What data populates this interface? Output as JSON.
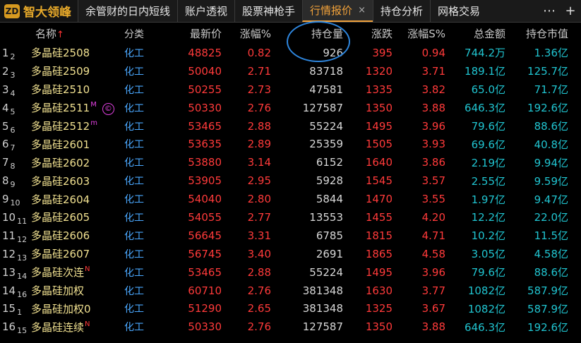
{
  "app": {
    "logo_mark": "ZD",
    "logo_text": "智大领峰"
  },
  "tabs": [
    {
      "label": "余管财的日内短线",
      "active": false
    },
    {
      "label": "账户透视",
      "active": false
    },
    {
      "label": "股票神枪手",
      "active": false
    },
    {
      "label": "行情报价",
      "active": true,
      "close": "×"
    },
    {
      "label": "持仓分析",
      "active": false
    },
    {
      "label": "网格交易",
      "active": false
    }
  ],
  "toolbar": {
    "more": "⋯",
    "add": "+"
  },
  "columns": {
    "name": "名称",
    "name_sort": "↑",
    "category": "分类",
    "price": "最新价",
    "pct": "涨幅%",
    "open_interest": "持仓量",
    "change": "涨跌",
    "pct_s": "涨幅S%",
    "amount": "总金额",
    "oi_value": "持仓市值"
  },
  "rows": [
    {
      "idx": "1",
      "sub": "2",
      "name": "多晶硅2508",
      "tag": "",
      "category": "化工",
      "price": "48825",
      "pct": "0.82",
      "oi": "926",
      "chg": "395",
      "pct_s": "0.94",
      "amt": "744.2万",
      "oi_value": "1.36亿"
    },
    {
      "idx": "2",
      "sub": "3",
      "name": "多晶硅2509",
      "tag": "",
      "category": "化工",
      "price": "50040",
      "pct": "2.71",
      "oi": "83718",
      "chg": "1320",
      "pct_s": "3.71",
      "amt": "189.1亿",
      "oi_value": "125.7亿"
    },
    {
      "idx": "3",
      "sub": "4",
      "name": "多晶硅2510",
      "tag": "",
      "category": "化工",
      "price": "50255",
      "pct": "2.73",
      "oi": "47581",
      "chg": "1335",
      "pct_s": "3.82",
      "amt": "65.0亿",
      "oi_value": "71.7亿"
    },
    {
      "idx": "4",
      "sub": "5",
      "name": "多晶硅2511",
      "tag": "M",
      "copy": "©",
      "category": "化工",
      "price": "50330",
      "pct": "2.76",
      "oi": "127587",
      "chg": "1350",
      "pct_s": "3.88",
      "amt": "646.3亿",
      "oi_value": "192.6亿"
    },
    {
      "idx": "5",
      "sub": "6",
      "name": "多晶硅2512",
      "tag": "m",
      "category": "化工",
      "price": "53465",
      "pct": "2.88",
      "oi": "55224",
      "chg": "1495",
      "pct_s": "3.96",
      "amt": "79.6亿",
      "oi_value": "88.6亿"
    },
    {
      "idx": "6",
      "sub": "7",
      "name": "多晶硅2601",
      "tag": "",
      "category": "化工",
      "price": "53635",
      "pct": "2.89",
      "oi": "25359",
      "chg": "1505",
      "pct_s": "3.93",
      "amt": "69.6亿",
      "oi_value": "40.8亿"
    },
    {
      "idx": "7",
      "sub": "8",
      "name": "多晶硅2602",
      "tag": "",
      "category": "化工",
      "price": "53880",
      "pct": "3.14",
      "oi": "6152",
      "chg": "1640",
      "pct_s": "3.86",
      "amt": "2.19亿",
      "oi_value": "9.94亿"
    },
    {
      "idx": "8",
      "sub": "9",
      "name": "多晶硅2603",
      "tag": "",
      "category": "化工",
      "price": "53905",
      "pct": "2.95",
      "oi": "5928",
      "chg": "1545",
      "pct_s": "3.57",
      "amt": "2.55亿",
      "oi_value": "9.59亿"
    },
    {
      "idx": "9",
      "sub": "10",
      "name": "多晶硅2604",
      "tag": "",
      "category": "化工",
      "price": "54040",
      "pct": "2.80",
      "oi": "5844",
      "chg": "1470",
      "pct_s": "3.55",
      "amt": "1.97亿",
      "oi_value": "9.47亿"
    },
    {
      "idx": "10",
      "sub": "11",
      "name": "多晶硅2605",
      "tag": "",
      "category": "化工",
      "price": "54055",
      "pct": "2.77",
      "oi": "13553",
      "chg": "1455",
      "pct_s": "4.20",
      "amt": "12.2亿",
      "oi_value": "22.0亿"
    },
    {
      "idx": "11",
      "sub": "12",
      "name": "多晶硅2606",
      "tag": "",
      "category": "化工",
      "price": "56645",
      "pct": "3.31",
      "oi": "6785",
      "chg": "1815",
      "pct_s": "4.71",
      "amt": "10.2亿",
      "oi_value": "11.5亿"
    },
    {
      "idx": "12",
      "sub": "13",
      "name": "多晶硅2607",
      "tag": "",
      "category": "化工",
      "price": "56745",
      "pct": "3.40",
      "oi": "2691",
      "chg": "1865",
      "pct_s": "4.58",
      "amt": "3.05亿",
      "oi_value": "4.58亿"
    },
    {
      "idx": "13",
      "sub": "14",
      "name": "多晶硅次连",
      "tag": "N",
      "category": "化工",
      "price": "53465",
      "pct": "2.88",
      "oi": "55224",
      "chg": "1495",
      "pct_s": "3.96",
      "amt": "79.6亿",
      "oi_value": "88.6亿"
    },
    {
      "idx": "14",
      "sub": "16",
      "name": "多晶硅加权",
      "tag": "",
      "category": "化工",
      "price": "60710",
      "pct": "2.76",
      "oi": "381348",
      "chg": "1630",
      "pct_s": "3.77",
      "amt": "1082亿",
      "oi_value": "587.9亿"
    },
    {
      "idx": "15",
      "sub": "1",
      "name": "多晶硅加权0",
      "tag": "",
      "category": "化工",
      "price": "51290",
      "pct": "2.65",
      "oi": "381348",
      "chg": "1325",
      "pct_s": "3.67",
      "amt": "1082亿",
      "oi_value": "587.9亿"
    },
    {
      "idx": "16",
      "sub": "15",
      "name": "多晶硅连续",
      "tag": "N",
      "category": "化工",
      "price": "50330",
      "pct": "2.76",
      "oi": "127587",
      "chg": "1350",
      "pct_s": "3.88",
      "amt": "646.3亿",
      "oi_value": "192.6亿"
    }
  ],
  "colors": {
    "up": "#ff3a3a",
    "name": "#f0e090",
    "category": "#4aa8ff",
    "amount": "#20c4d0",
    "accent": "#f0a13a",
    "highlight": "#2e86de"
  }
}
